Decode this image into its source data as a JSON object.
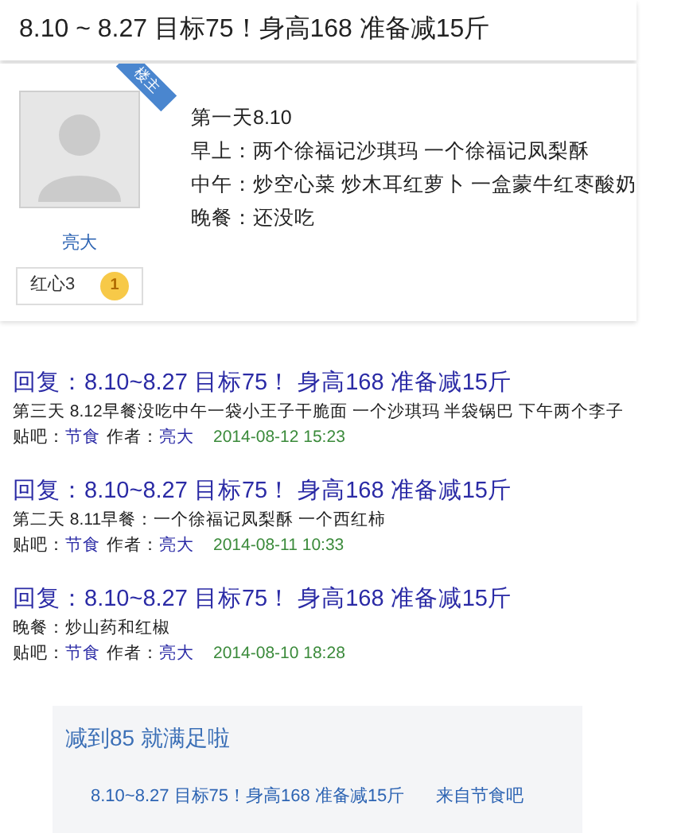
{
  "thread_title": "8.10 ~ 8.27 目标75！身高168 准备减15斤",
  "post": {
    "badge": "楼主",
    "author": "亮大",
    "honor": "红心3",
    "level": "1",
    "lines": [
      "第一天8.10",
      "早上：两个徐福记沙琪玛 一个徐福记凤梨酥",
      "中午：炒空心菜 炒木耳红萝卜 一盒蒙牛红枣酸奶",
      "晚餐：还没吃"
    ]
  },
  "replies": [
    {
      "title": "回复：8.10~8.27 目标75！ 身高168 准备减15斤",
      "excerpt": "第三天 8.12早餐没吃中午一袋小王子干脆面 一个沙琪玛 半袋锅巴 下午两个李子",
      "forum_label": "贴吧：",
      "forum": "节食",
      "author_label": "作者：",
      "author": "亮大",
      "time": "2014-08-12 15:23"
    },
    {
      "title": "回复：8.10~8.27 目标75！ 身高168 准备减15斤",
      "excerpt": "第二天 8.11早餐：一个徐福记凤梨酥 一个西红柿",
      "forum_label": "贴吧：",
      "forum": "节食",
      "author_label": "作者：",
      "author": "亮大",
      "time": "2014-08-11 10:33"
    },
    {
      "title": "回复：8.10~8.27 目标75！ 身高168 准备减15斤",
      "excerpt": "晚餐：炒山药和红椒",
      "forum_label": "贴吧：",
      "forum": "节食",
      "author_label": "作者：",
      "author": "亮大",
      "time": "2014-08-10 18:28"
    }
  ],
  "quote": {
    "comment": "减到85 就满足啦",
    "link": "8.10~8.27 目标75！身高168 准备减15斤",
    "source": "来自节食吧"
  }
}
